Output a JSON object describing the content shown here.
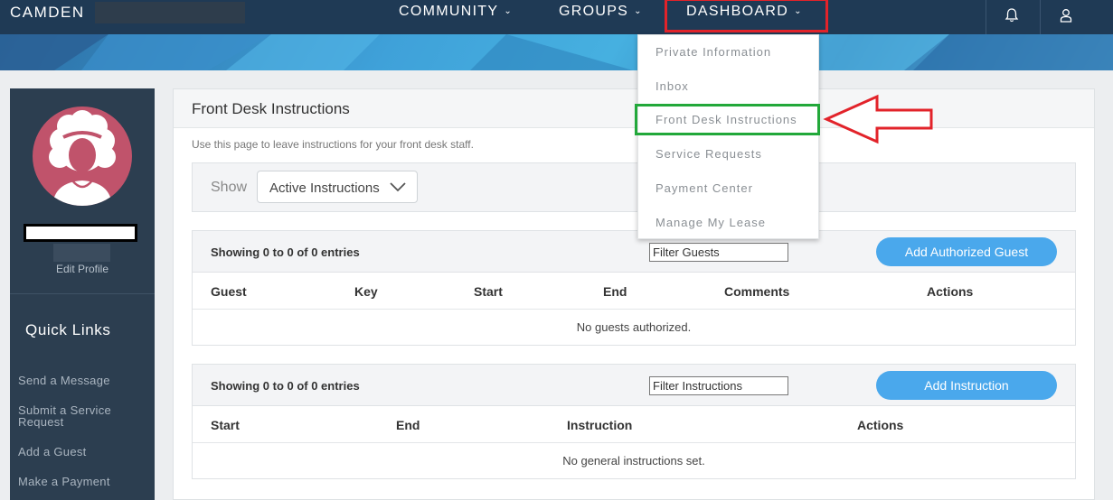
{
  "brand": {
    "name": "CAMDEN"
  },
  "nav": {
    "community": "COMMUNITY",
    "groups": "GROUPS",
    "dashboard": "DASHBOARD",
    "notifications_icon": "bell-icon",
    "account_icon": "user-icon"
  },
  "dropdown": {
    "items": [
      "Private Information",
      "Inbox",
      "Front Desk Instructions",
      "Service Requests",
      "Payment Center",
      "Manage My Lease"
    ]
  },
  "sidebar": {
    "avatar_icon": "avatar-icon",
    "edit_profile": "Edit Profile",
    "quick_links_title": "Quick Links",
    "links": [
      "Send a Message",
      "Submit a Service Request",
      "Add a Guest",
      "Make a Payment"
    ]
  },
  "main": {
    "title": "Front Desk Instructions",
    "intro": "Use this page to leave instructions for your front desk staff.",
    "show_label": "Show",
    "show_value": "Active Instructions",
    "guests": {
      "showing": "Showing 0 to 0 of 0 entries",
      "filter_placeholder": "Filter Guests",
      "button": "Add Authorized Guest",
      "columns": [
        "Guest",
        "Key",
        "Start",
        "End",
        "Comments",
        "Actions"
      ],
      "empty": "No guests authorized."
    },
    "instructions": {
      "showing": "Showing 0 to 0 of 0 entries",
      "filter_placeholder": "Filter Instructions",
      "button": "Add Instruction",
      "columns": [
        "Start",
        "End",
        "Instruction",
        "Actions"
      ],
      "empty": "No general instructions set."
    }
  },
  "colors": {
    "nav_bg": "#1f3a55",
    "sidebar_bg": "#2c3e50",
    "button_blue": "#4aa8ec",
    "highlight_red": "#e2232a",
    "highlight_green": "#22a83a",
    "avatar_bg": "#c0536b"
  }
}
